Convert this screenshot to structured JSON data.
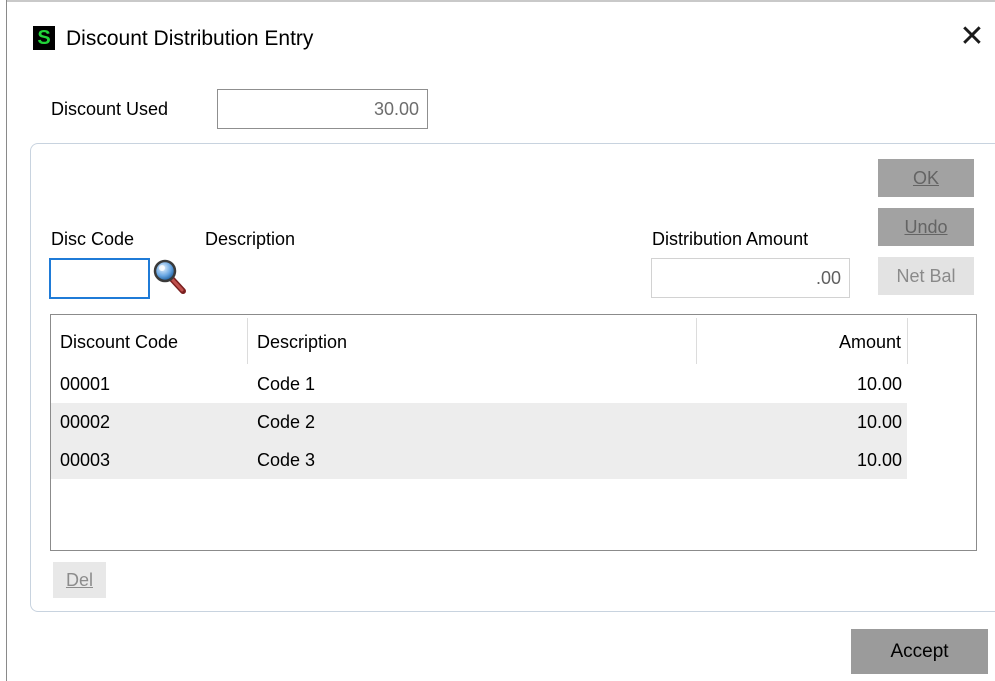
{
  "window": {
    "app_icon_letter": "S",
    "title": "Discount Distribution Entry",
    "close_glyph": "✕"
  },
  "discount_used": {
    "label": "Discount Used",
    "value": "30.00"
  },
  "entry": {
    "ok_label": "OK",
    "undo_label": "Undo",
    "net_bal_label": "Net Bal",
    "disc_code_label": "Disc Code",
    "description_label": "Description",
    "distribution_amount_label": "Distribution Amount",
    "disc_code_value": "",
    "distribution_amount_value": ".00"
  },
  "grid": {
    "columns": [
      "Discount Code",
      "Description",
      "Amount"
    ],
    "rows": [
      {
        "code": "00001",
        "description": "Code 1",
        "amount": "10.00"
      },
      {
        "code": "00002",
        "description": "Code 2",
        "amount": "10.00"
      },
      {
        "code": "00003",
        "description": "Code 3",
        "amount": "10.00"
      }
    ]
  },
  "buttons": {
    "del_label": "Del",
    "accept_label": "Accept"
  },
  "colors": {
    "app_icon_bg": "#000000",
    "app_icon_fg": "#22d339",
    "input_focus_border": "#1f7bd7",
    "disabled_button_bg": "#a2a2a2"
  }
}
